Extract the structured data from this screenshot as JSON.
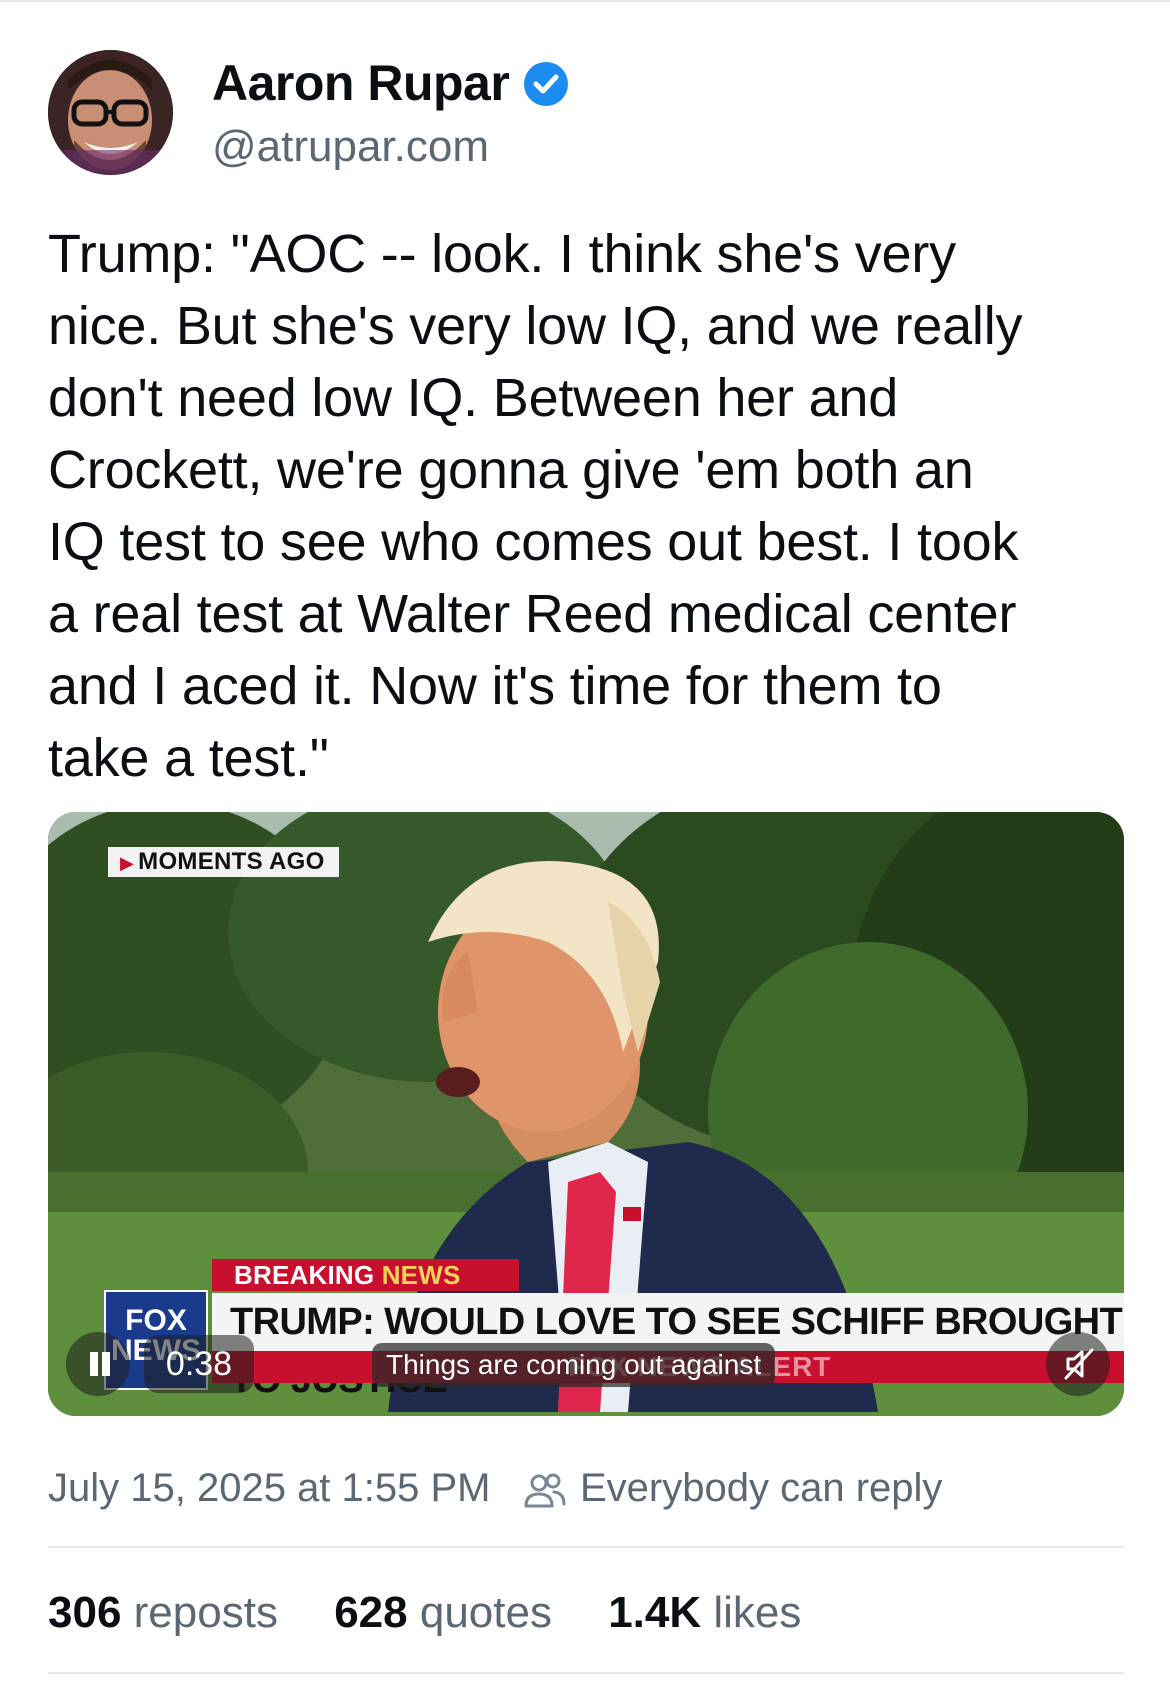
{
  "author": {
    "display_name": "Aaron Rupar",
    "handle": "@atrupar.com",
    "verified": true,
    "verified_color": "#1d8cf0"
  },
  "post": {
    "text": "Trump: \"AOC -- look. I think she's very\nnice. But she's very low IQ, and we really\ndon't need low IQ. Between her and\nCrockett, we're gonna give 'em both an\nIQ test to see who comes out best. I took\na real test at Walter Reed medical center\nand I aced it. Now it's time for them to\ntake a test.\""
  },
  "video": {
    "tag": "MOMENTS AGO",
    "breaking_label_1": "BREAKING ",
    "breaking_label_2": "NEWS",
    "headline": "TRUMP: WOULD LOVE TO SEE SCHIFF BROUGHT TO JUSTICE",
    "ticker": "FOX NEWS ALERT",
    "network_line1": "FOX",
    "network_line2": "NEWS",
    "timestamp": "0:38",
    "caption": "Things are coming out against",
    "accent_red": "#c8102e",
    "network_blue": "#1a3a8c"
  },
  "meta": {
    "date": "July 15, 2025 at 1:55 PM",
    "reply_setting": "Everybody can reply"
  },
  "stats": {
    "reposts_count": "306",
    "reposts_label": "reposts",
    "quotes_count": "628",
    "quotes_label": "quotes",
    "likes_count": "1.4K",
    "likes_label": "likes"
  }
}
